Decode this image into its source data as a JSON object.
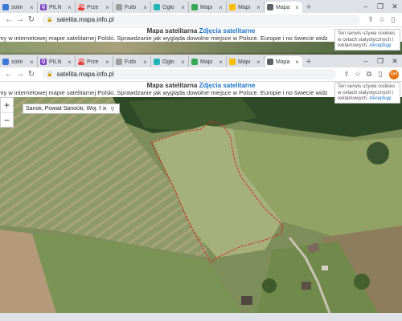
{
  "back_window": {
    "tabs": [
      {
        "title": "solin",
        "icon": "doc-icon",
        "color": "#3c78d8",
        "glyph": ""
      },
      {
        "title": "PILN",
        "icon": "search-q-icon",
        "color": "#7b3fbf",
        "glyph": "Q"
      },
      {
        "title": "Prze",
        "icon": "ps-logo-icon",
        "color": "#e53935",
        "glyph": "PS"
      },
      {
        "title": "Futb",
        "icon": "doc-icon",
        "color": "#9e9e9e",
        "glyph": ""
      },
      {
        "title": "Ogło",
        "icon": "olx-logo-icon",
        "color": "#23b5b5",
        "glyph": ""
      },
      {
        "title": "Mapi",
        "icon": "map-pin-icon",
        "color": "#34a853",
        "glyph": ""
      },
      {
        "title": "Mapi",
        "icon": "triangle-icon",
        "color": "#fbbc04",
        "glyph": ""
      },
      {
        "title": "Mapa",
        "icon": "globe-icon",
        "color": "#5f6368",
        "glyph": ""
      }
    ],
    "url": "satelita.mapa.info.pl",
    "description": "tamy w internetowej mapie satelitarnej Polski. Sprawdzanie jak wygląda dowolne miejsce w Polsce. Europie i no świecie widz",
    "header_a": "Mapa satelitarna",
    "header_b": "Zdjęcia satelitarne",
    "cookie": {
      "text": "Ten serwis używa cookies w celach statystycznych i reklamowych.",
      "accept": "Akceptuję"
    }
  },
  "front_window": {
    "tabs": [
      {
        "title": "solin",
        "icon": "doc-icon",
        "color": "#3c78d8",
        "glyph": ""
      },
      {
        "title": "PILN",
        "icon": "search-q-icon",
        "color": "#7b3fbf",
        "glyph": "Q"
      },
      {
        "title": "Prze",
        "icon": "ps-logo-icon",
        "color": "#e53935",
        "glyph": "PS"
      },
      {
        "title": "Futb",
        "icon": "doc-icon",
        "color": "#9e9e9e",
        "glyph": ""
      },
      {
        "title": "Ogło",
        "icon": "olx-logo-icon",
        "color": "#23b5b5",
        "glyph": ""
      },
      {
        "title": "Mapi",
        "icon": "map-pin-icon",
        "color": "#34a853",
        "glyph": ""
      },
      {
        "title": "Mapi",
        "icon": "triangle-icon",
        "color": "#fbbc04",
        "glyph": ""
      },
      {
        "title": "Mapa",
        "icon": "globe-icon",
        "color": "#5f6368",
        "glyph": ""
      }
    ],
    "url": "satelita.mapa.info.pl",
    "header_a": "Mapa satelitarna",
    "header_b": "Zdjęcia satelitarne",
    "description": "tamy w internetowej mapie satelitarnej Polski. Sprawdzanie jak wygląda dowolne miejsce w Polsce. Europie i no świecie widz",
    "cookie": {
      "text": "Ten serwis używa cookies w celach statystycznych i reklamowych.",
      "accept": "Akceptuję"
    },
    "search_value": "Sanok, Powiat Sanocki, Woj. Po",
    "zoom_in": "+",
    "zoom_out": "−",
    "avatar": "DH"
  }
}
